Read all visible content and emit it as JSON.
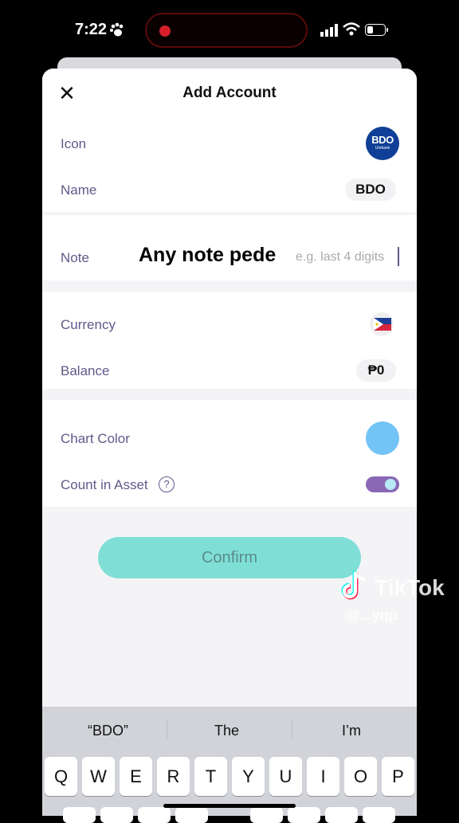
{
  "status_bar": {
    "time": "7:22"
  },
  "header": {
    "title": "Add Account",
    "close": "✕"
  },
  "rows": {
    "icon_label": "Icon",
    "name_label": "Name",
    "name_value": "BDO",
    "bank_logo_text": "BDO",
    "bank_logo_sub": "Unibank",
    "note_label": "Note",
    "note_typed": "Any note pede",
    "note_placeholder": "e.g. last 4 digits",
    "currency_label": "Currency",
    "balance_label": "Balance",
    "balance_value": "₱0",
    "chart_color_label": "Chart Color",
    "chart_color": "#72c3f6",
    "count_in_asset_label": "Count in Asset",
    "help": "?"
  },
  "confirm_label": "Confirm",
  "watermark": {
    "brand": "TikTok",
    "handle": "@...yqp"
  },
  "keyboard": {
    "suggestions": [
      "“BDO”",
      "The",
      "I’m"
    ],
    "row1": [
      "Q",
      "W",
      "E",
      "R",
      "T",
      "Y",
      "U",
      "I",
      "O",
      "P"
    ]
  }
}
